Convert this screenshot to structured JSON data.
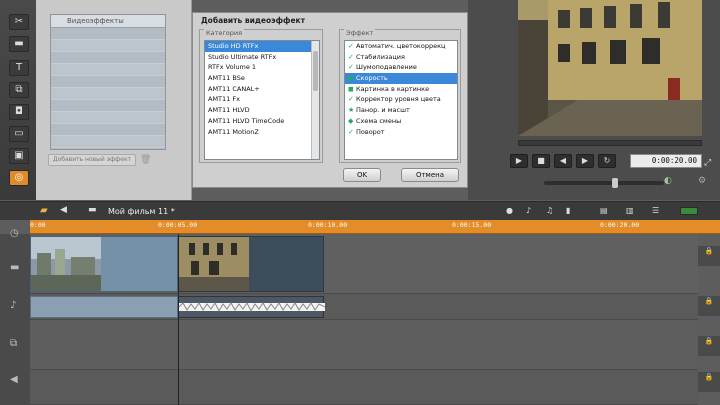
{
  "toolbar_left": {
    "tools": [
      {
        "icon": "scissors-icon",
        "glyph": "✂"
      },
      {
        "icon": "film-icon",
        "glyph": "▬"
      },
      {
        "icon": "title-icon",
        "glyph": "T"
      },
      {
        "icon": "transitions-icon",
        "glyph": "⧉"
      },
      {
        "icon": "camera-icon",
        "glyph": "◘"
      },
      {
        "icon": "disk-icon",
        "glyph": "▭"
      },
      {
        "icon": "photo-icon",
        "glyph": "▣"
      },
      {
        "icon": "video-effects-icon",
        "glyph": "◎",
        "active": true
      }
    ]
  },
  "effects_panel": {
    "header": "Видеоэффекты",
    "new_effect_button": "Добавить новый эффект"
  },
  "dialog": {
    "title": "Добавить видеоэффект",
    "categories_label": "Категория",
    "effects_label": "Эффект",
    "categories": [
      {
        "label": "Studio HD RTFx",
        "selected": true
      },
      {
        "label": "Studio Ultimate RTFx",
        "selected": false
      },
      {
        "label": "RTFx Volume 1",
        "selected": false
      },
      {
        "label": "AMT11 BSe",
        "selected": false
      },
      {
        "label": "AMT11 CANAL+",
        "selected": false
      },
      {
        "label": "AMT11 Fx",
        "selected": false
      },
      {
        "label": "AMT11 HLVD",
        "selected": false
      },
      {
        "label": "AMT11 HLVD TimeCode",
        "selected": false
      },
      {
        "label": "AMT11 MotionZ",
        "selected": false
      }
    ],
    "effects": [
      {
        "label": "Автоматич. цветокоррекц",
        "selected": false
      },
      {
        "label": "Стабилизация",
        "selected": false
      },
      {
        "label": "Шумоподавление",
        "selected": false
      },
      {
        "label": "Скорость",
        "selected": true
      },
      {
        "label": "Картинка в картинке",
        "selected": false
      },
      {
        "label": "Корректор уровня цвета",
        "selected": false
      },
      {
        "label": "Панор. и масшт",
        "selected": false
      },
      {
        "label": "Схема смены",
        "selected": false
      },
      {
        "label": "Поворот",
        "selected": false
      }
    ],
    "ok_button": "OK",
    "cancel_button": "Отмена"
  },
  "player": {
    "timecode": "0:00:20.00",
    "volume_level": 0.55
  },
  "timeline": {
    "project_name": "Мой фильм 11 *",
    "ruler_ticks": [
      "0:00",
      "0:00:05.00",
      "0:00:10.00",
      "0:00:15.00",
      "0:00:20.00"
    ]
  },
  "colors": {
    "accent": "#e38c28",
    "selection": "#3b87d8"
  }
}
